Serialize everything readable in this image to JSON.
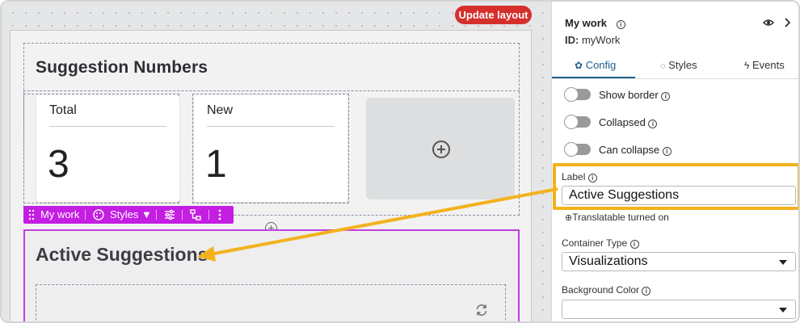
{
  "canvas": {
    "update_button": "Update layout",
    "section1": {
      "title": "Suggestion Numbers",
      "cards": [
        {
          "label": "Total",
          "value": "3"
        },
        {
          "label": "New",
          "value": "1"
        }
      ]
    },
    "toolbar": {
      "name": "My work",
      "styles_label": "Styles"
    },
    "section2": {
      "title": "Active Suggestions"
    }
  },
  "panel": {
    "title": "My work",
    "id_label": "ID:",
    "id_value": "myWork",
    "tabs": [
      {
        "label": "Config",
        "active": true
      },
      {
        "label": "Styles",
        "active": false
      },
      {
        "label": "Events",
        "active": false
      }
    ],
    "toggles": [
      {
        "label": "Show border",
        "on": false
      },
      {
        "label": "Collapsed",
        "on": false
      },
      {
        "label": "Can collapse",
        "on": false
      }
    ],
    "label_field": {
      "label": "Label",
      "value": "Active Suggestions"
    },
    "translatable_note": "Translatable turned on",
    "container_type": {
      "label": "Container Type",
      "value": "Visualizations"
    },
    "background_color": {
      "label": "Background Color",
      "value": ""
    }
  },
  "colors": {
    "accent": "#f3b21d",
    "selection": "#c41ee3",
    "update_button": "#d52f2c",
    "active_tab": "#1f5f8e"
  }
}
